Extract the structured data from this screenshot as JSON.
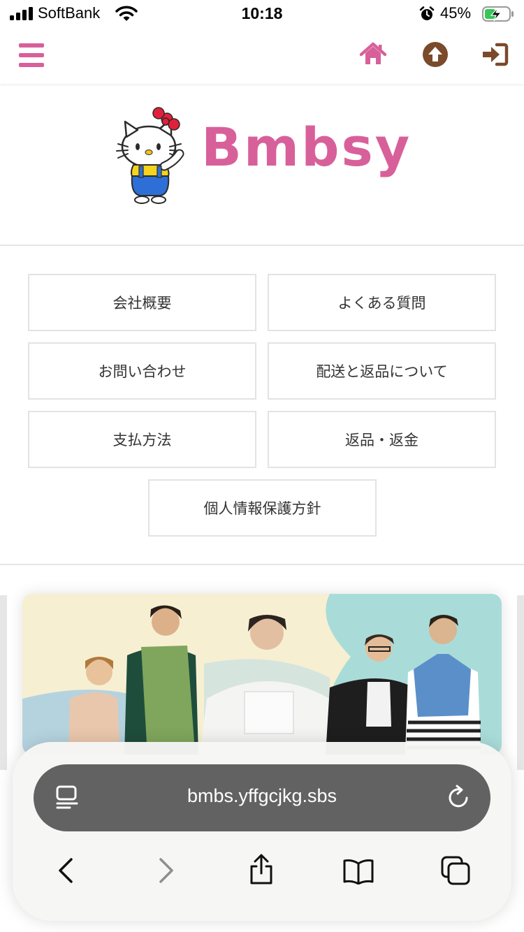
{
  "status_bar": {
    "carrier": "SoftBank",
    "time": "10:18",
    "battery_percent": "45%",
    "battery_level": 0.45,
    "charging": true
  },
  "header": {
    "icons": [
      "menu-icon",
      "home-icon",
      "arrow-up-circle-icon",
      "sign-in-icon"
    ],
    "accent_color": "#d8609a",
    "brown_color": "#7a4a2a"
  },
  "logo": {
    "brand_text": "Bmbsy",
    "mascot": "hello-kitty"
  },
  "links": [
    {
      "label": "会社概要"
    },
    {
      "label": "よくある質問"
    },
    {
      "label": "お問い合わせ"
    },
    {
      "label": "配送と返品について"
    },
    {
      "label": "支払方法"
    },
    {
      "label": "返品・返金"
    },
    {
      "label": "個人情報保護方針"
    }
  ],
  "banner": {
    "image": "fashion-models-banner"
  },
  "browser": {
    "url": "bmbs.yffgcjkg.sbs",
    "toolbar_icons": [
      "back-icon",
      "forward-icon",
      "share-icon",
      "bookmarks-icon",
      "tabs-icon"
    ]
  }
}
